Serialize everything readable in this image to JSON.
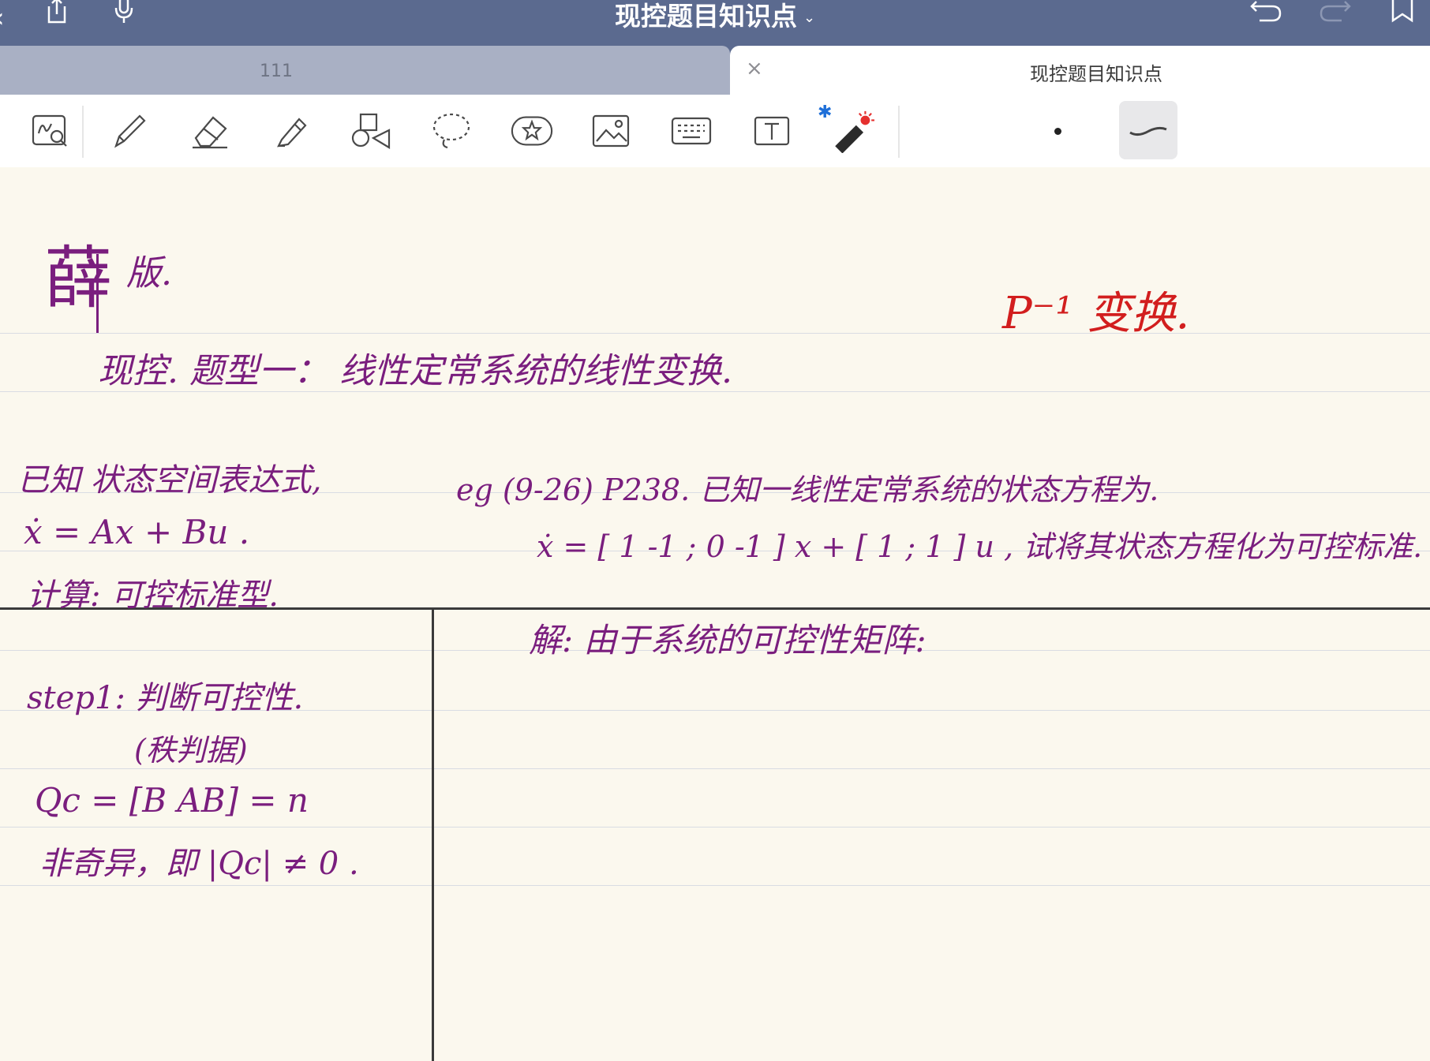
{
  "window": {
    "title": "现控题目知识点",
    "title_chevron": "⌄"
  },
  "tabs": [
    {
      "label": "111"
    },
    {
      "close": "×",
      "label": "现控题目知识点"
    }
  ],
  "toolbar": {
    "tools": [
      "zoom-write-icon",
      "pen-icon",
      "eraser-icon",
      "highlighter-icon",
      "shapes-icon",
      "lasso-icon",
      "sticker-icon",
      "image-icon",
      "keyboard-icon",
      "text-box-icon",
      "laser-pointer-icon"
    ],
    "bluetooth": "✱"
  },
  "colors": {
    "nav": "#5B6A8F",
    "ink_purple": "#7A1E7E",
    "ink_red": "#D21E1E",
    "paper": "#FBF8EE"
  },
  "notes": {
    "header_char": "薛",
    "header_ban": "版.",
    "header_line": "现控. 题型一：  线性定常系统的线性变换.",
    "red_note": "P⁻¹ 变换.",
    "left": [
      "已知 状态空间表达式,",
      "ẋ = Ax + Bu .",
      "计算: 可控标准型.",
      "step1: 判断可控性.",
      "(秩判据)",
      "Qc = [B  AB] = n",
      "非奇异，即 |Qc| ≠ 0 ."
    ],
    "right": [
      "eg (9-26) P238.  已知一线性定常系统的状态方程为.",
      "ẋ = [ 1  -1 ; 0  -1 ] x + [ 1 ; 1 ] u ,  试将其状态方程化为可控标准.",
      "解:  由于系统的可控性矩阵:"
    ]
  }
}
